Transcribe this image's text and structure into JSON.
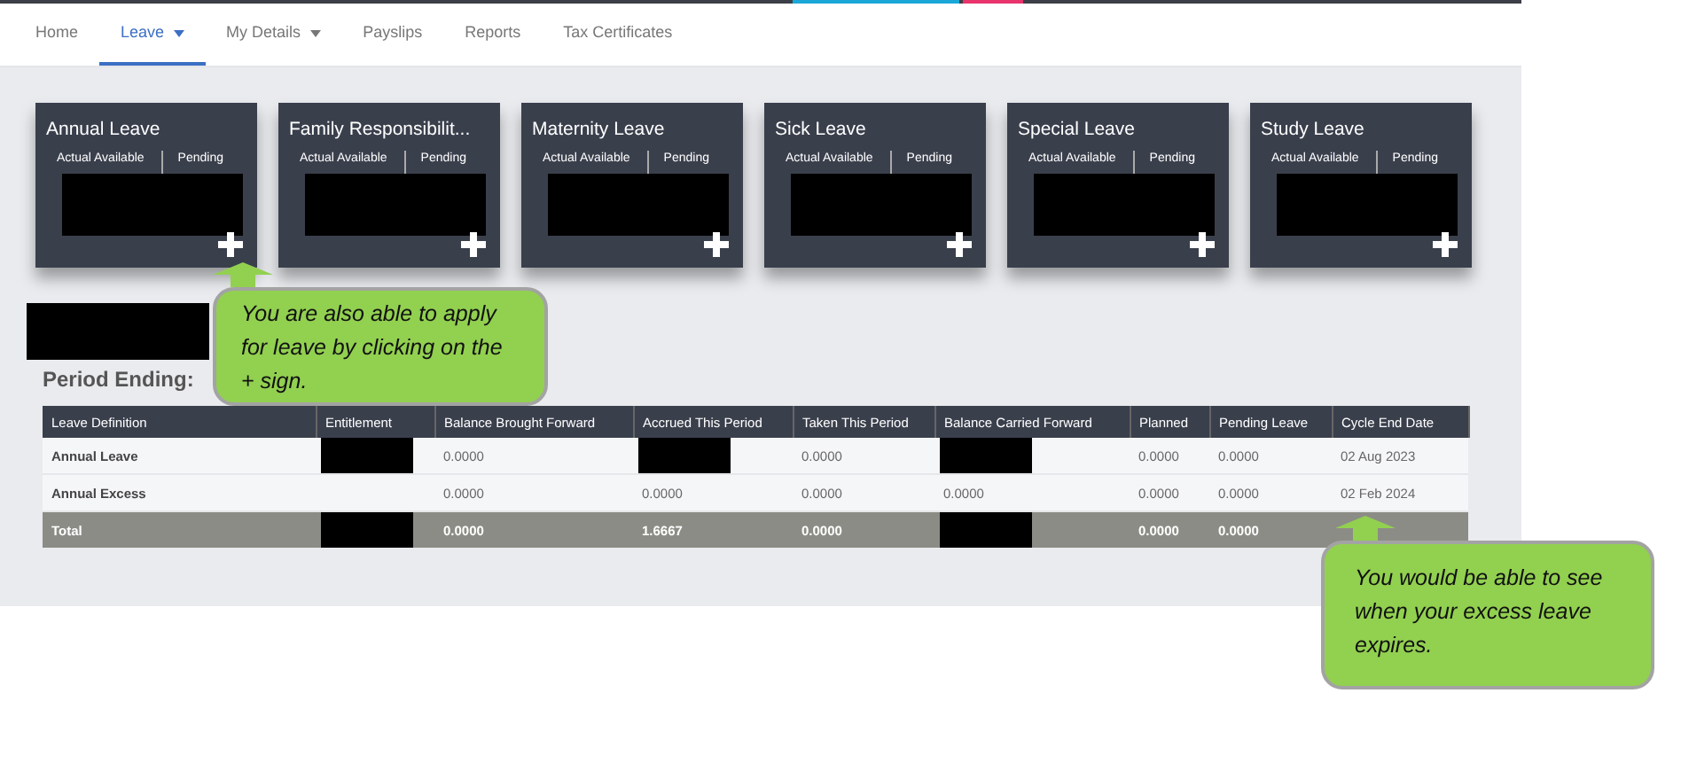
{
  "nav": [
    {
      "label": "Home",
      "selected": false,
      "dropdown": false
    },
    {
      "label": "Leave",
      "selected": true,
      "dropdown": true
    },
    {
      "label": "My Details",
      "selected": false,
      "dropdown": true
    },
    {
      "label": "Payslips",
      "selected": false,
      "dropdown": false
    },
    {
      "label": "Reports",
      "selected": false,
      "dropdown": false
    },
    {
      "label": "Tax Certificates",
      "selected": false,
      "dropdown": false
    }
  ],
  "leave_cards": [
    {
      "title": "Annual Leave",
      "available_label": "Actual Available",
      "pending_label": "Pending"
    },
    {
      "title": "Family Responsibilit...",
      "available_label": "Actual Available",
      "pending_label": "Pending"
    },
    {
      "title": "Maternity Leave",
      "available_label": "Actual Available",
      "pending_label": "Pending"
    },
    {
      "title": "Sick Leave",
      "available_label": "Actual Available",
      "pending_label": "Pending"
    },
    {
      "title": "Special Leave",
      "available_label": "Actual Available",
      "pending_label": "Pending"
    },
    {
      "title": "Study Leave",
      "available_label": "Actual Available",
      "pending_label": "Pending"
    }
  ],
  "period_label": "Period Ending:",
  "table": {
    "columns": [
      "Leave Definition",
      "Entitlement",
      "Balance Brought Forward",
      "Accrued This Period",
      "Taken This Period",
      "Balance Carried Forward",
      "Planned",
      "Pending Leave",
      "Cycle End Date"
    ],
    "rows": [
      {
        "kind": "data",
        "cells": [
          {
            "kind": "text",
            "text": "Annual Leave"
          },
          {
            "kind": "redacted"
          },
          {
            "kind": "text",
            "text": "0.0000"
          },
          {
            "kind": "redacted"
          },
          {
            "kind": "text",
            "text": "0.0000"
          },
          {
            "kind": "redacted"
          },
          {
            "kind": "text",
            "text": "0.0000"
          },
          {
            "kind": "text",
            "text": "0.0000"
          },
          {
            "kind": "text",
            "text": "02 Aug 2023"
          }
        ]
      },
      {
        "kind": "data",
        "cells": [
          {
            "kind": "text",
            "text": "Annual Excess"
          },
          {
            "kind": "empty"
          },
          {
            "kind": "text",
            "text": "0.0000"
          },
          {
            "kind": "text",
            "text": "0.0000"
          },
          {
            "kind": "text",
            "text": "0.0000"
          },
          {
            "kind": "text",
            "text": "0.0000"
          },
          {
            "kind": "text",
            "text": "0.0000"
          },
          {
            "kind": "text",
            "text": "0.0000"
          },
          {
            "kind": "text",
            "text": "02 Feb 2024"
          }
        ]
      },
      {
        "kind": "total",
        "cells": [
          {
            "kind": "text",
            "text": "Total"
          },
          {
            "kind": "redacted"
          },
          {
            "kind": "text",
            "text": "0.0000"
          },
          {
            "kind": "text",
            "text": "1.6667"
          },
          {
            "kind": "text",
            "text": "0.0000"
          },
          {
            "kind": "redacted"
          },
          {
            "kind": "text",
            "text": "0.0000"
          },
          {
            "kind": "text",
            "text": "0.0000"
          },
          {
            "kind": "empty"
          }
        ]
      }
    ]
  },
  "callouts": [
    {
      "text": "You are also able to apply for leave by clicking on the + sign."
    },
    {
      "text": "You would be able to see when your excess leave expires."
    }
  ]
}
